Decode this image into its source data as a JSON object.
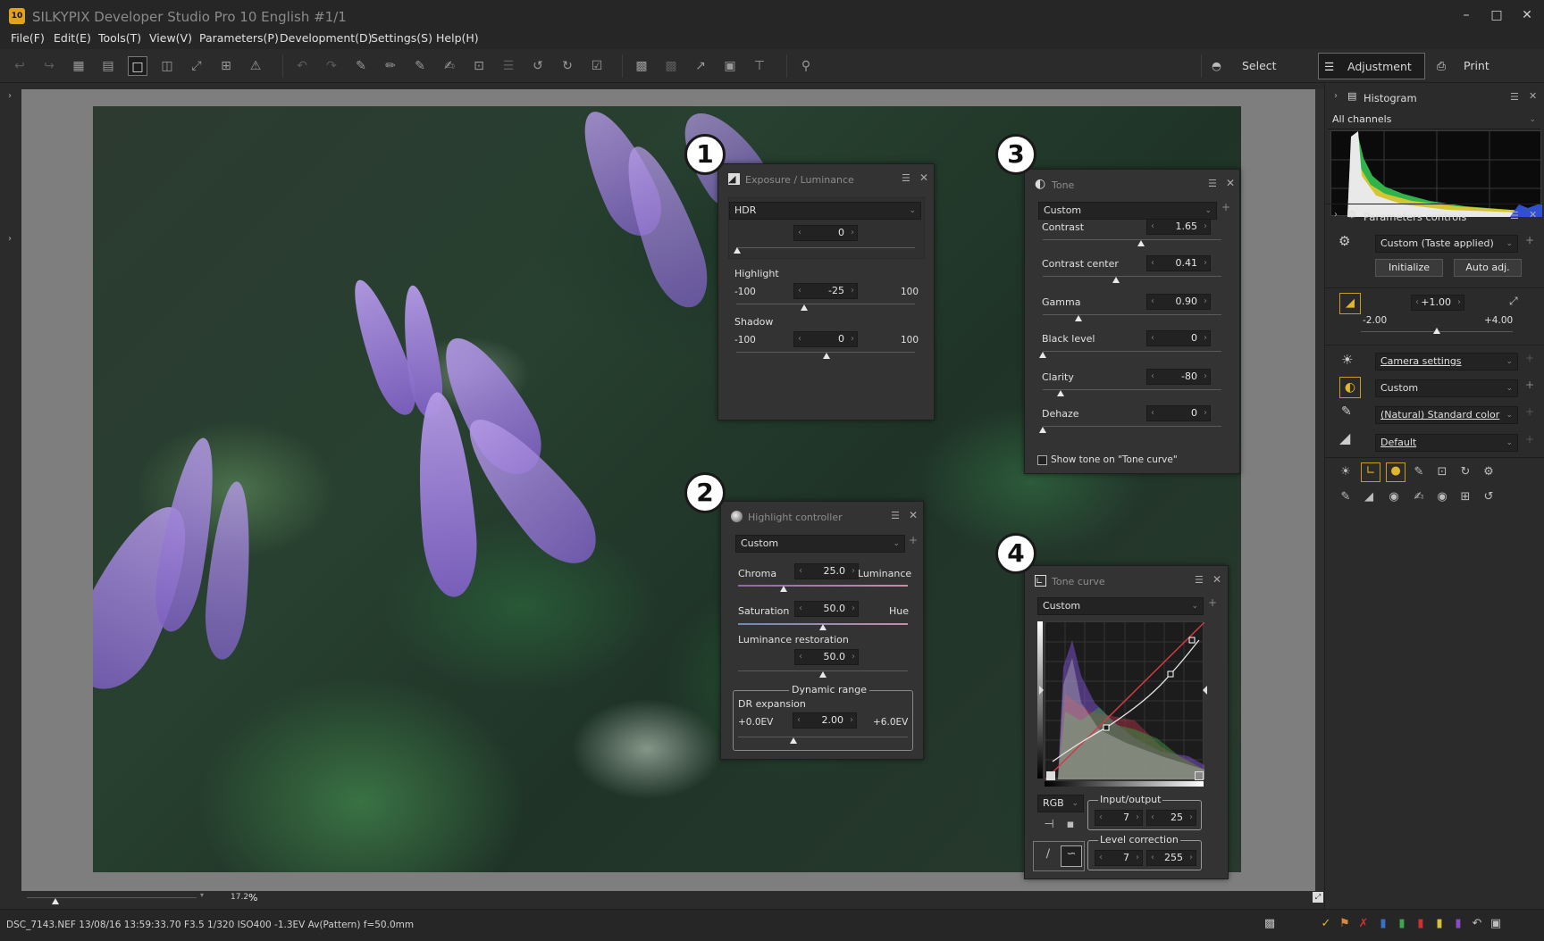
{
  "window": {
    "app_icon": "10",
    "title": "SILKYPIX Developer Studio Pro 10 English   #1/1",
    "minimize": "–",
    "maximize": "□",
    "close": "✕"
  },
  "menu": [
    "File(F)",
    "Edit(E)",
    "Tools(T)",
    "View(V)",
    "Parameters(P)",
    "Development(D)",
    "Settings(S)",
    "Help(H)"
  ],
  "toolbar": {
    "modes": {
      "select": "Select",
      "adjustment": "Adjustment",
      "print": "Print"
    }
  },
  "viewer": {
    "zoom_value": "17.2",
    "zoom_unit": "%"
  },
  "status": {
    "info": "DSC_7143.NEF 13/08/16 13:59:33.70 F3.5 1/320 ISO400 -1.3EV Av(Pattern) f=50.0mm"
  },
  "badges": [
    "1",
    "2",
    "3",
    "4"
  ],
  "exposure_panel": {
    "title": "Exposure / Luminance",
    "mode": "HDR",
    "hdr_value": "0",
    "highlight_label": "Highlight",
    "highlight_min": "-100",
    "highlight_value": "-25",
    "highlight_max": "100",
    "shadow_label": "Shadow",
    "shadow_min": "-100",
    "shadow_value": "0",
    "shadow_max": "100"
  },
  "highlight_panel": {
    "title": "Highlight controller",
    "preset": "Custom",
    "chroma_label": "Chroma",
    "chroma_value": "25.0",
    "luminance_label": "Luminance",
    "saturation_label": "Saturation",
    "saturation_value": "50.0",
    "hue_label": "Hue",
    "lum_restore_label": "Luminance restoration",
    "lum_restore_value": "50.0",
    "dynamic_range_label": "Dynamic range",
    "dr_expansion_label": "DR expansion",
    "dr_min": "+0.0EV",
    "dr_value": "2.00",
    "dr_max": "+6.0EV"
  },
  "tone_panel": {
    "title": "Tone",
    "preset": "Custom",
    "rows": [
      {
        "label": "Contrast",
        "value": "1.65",
        "level": 0.55
      },
      {
        "label": "Contrast center",
        "value": "0.41",
        "level": 0.41
      },
      {
        "label": "Gamma",
        "value": "0.90",
        "level": 0.2
      },
      {
        "label": "Black level",
        "value": "0",
        "level": 0.0
      },
      {
        "label": "Clarity",
        "value": "-80",
        "level": 0.1
      },
      {
        "label": "Dehaze",
        "value": "0",
        "level": 0.0
      }
    ],
    "show_tone_label": "Show tone on \"Tone curve\""
  },
  "tonecurve_panel": {
    "title": "Tone curve",
    "preset": "Custom",
    "channel": "RGB",
    "io_label": "Input/output",
    "io_in": "7",
    "io_out": "25",
    "level_label": "Level correction",
    "level_in": "7",
    "level_out": "255"
  },
  "histogram": {
    "title": "Histogram",
    "channel": "All channels"
  },
  "params": {
    "title": "Parameters controls",
    "preset": "Custom (Taste applied)",
    "initialize": "Initialize",
    "auto_adj": "Auto adj.",
    "exposure_value": "+1.00",
    "exposure_min": "-2.00",
    "exposure_max": "+4.00",
    "exposure_level": 0.5,
    "wb": "Camera settings",
    "tone": "Custom",
    "color": "(Natural) Standard color",
    "sharpness": "Default"
  },
  "colors": {
    "accent_yellow": "#e0b62a",
    "curve_red": "#d23a4a",
    "photo_purple": "#9b7ad6"
  }
}
